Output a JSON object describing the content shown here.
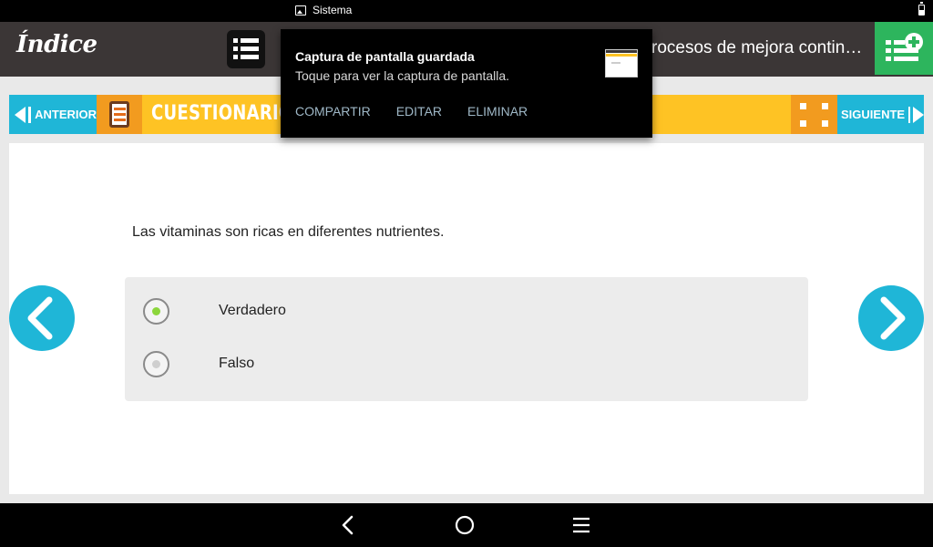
{
  "status_bar": {
    "notification_label": "Sistema"
  },
  "header": {
    "logo": "Índice",
    "title": "rocesos de mejora contin…"
  },
  "nav": {
    "prev_label": "ANTERIOR",
    "section_label": "CUESTIONARIO",
    "next_label": "SIGUIENTE"
  },
  "quiz": {
    "question": "Las vitaminas son ricas en diferentes nutrientes.",
    "options": [
      {
        "label": "Verdadero",
        "selected": true
      },
      {
        "label": "Falso",
        "selected": false
      }
    ]
  },
  "notification": {
    "title": "Captura de pantalla guardada",
    "text": "Toque para ver la captura de pantalla.",
    "actions": [
      "COMPARTIR",
      "EDITAR",
      "ELIMINAR"
    ]
  },
  "colors": {
    "header_bg": "#3b3636",
    "accent_blue": "#1fb6d7",
    "accent_yellow": "#fec324",
    "accent_orange": "#f29b1f",
    "accent_green": "#2db55d",
    "radio_selected": "#8cd63c"
  },
  "icons": [
    "image-icon",
    "battery-icon",
    "menu-list-icon",
    "add-list-icon",
    "arrow-left-icon",
    "arrow-right-icon",
    "quiz-clipboard-icon",
    "expand-icon",
    "chevron-left-icon",
    "chevron-right-icon",
    "back-icon",
    "home-icon",
    "recents-icon"
  ]
}
